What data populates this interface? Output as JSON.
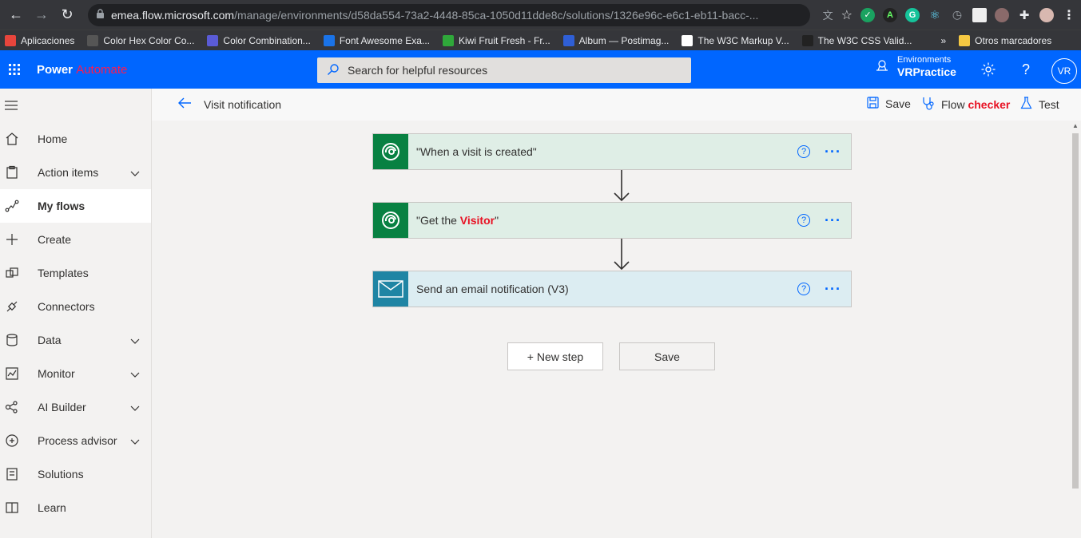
{
  "browser": {
    "url_host": "emea.flow.microsoft.com",
    "url_path": "/manage/environments/d58da554-73a2-4448-85ca-1050d11dde8c/solutions/1326e96c-e6c1-eb11-bacc-..."
  },
  "bookmarks": [
    {
      "label": "Aplicaciones",
      "color": "#e8453c"
    },
    {
      "label": "Color Hex Color Co...",
      "color": "#555555"
    },
    {
      "label": "Color Combination...",
      "color": "#5a5bd6"
    },
    {
      "label": "Font Awesome Exa...",
      "color": "#1a73e8"
    },
    {
      "label": "Kiwi Fruit Fresh - Fr...",
      "color": "#2fa83a"
    },
    {
      "label": "Album — Postimag...",
      "color": "#2f5fd6"
    },
    {
      "label": "The W3C Markup V...",
      "color": "#ffffff"
    },
    {
      "label": "The W3C CSS Valid...",
      "color": "#222222"
    }
  ],
  "bookmarks_overflow": "»",
  "bookmarks_other": "Otros marcadores",
  "header": {
    "brand_1": "Power",
    "brand_2": "Automate",
    "search_placeholder": "Search for helpful resources",
    "env_label": "Environments",
    "env_value": "VRPractice",
    "help": "?",
    "avatar": "VR",
    "accent": "#0066ff"
  },
  "sidebar": {
    "items": [
      {
        "label": "Home",
        "icon": "home-icon",
        "chevron": false
      },
      {
        "label": "Action items",
        "icon": "clipboard-icon",
        "chevron": true
      },
      {
        "label": "My flows",
        "icon": "flows-icon",
        "chevron": false,
        "active": true
      },
      {
        "label": "Create",
        "icon": "plus-icon",
        "chevron": false
      },
      {
        "label": "Templates",
        "icon": "templates-icon",
        "chevron": false
      },
      {
        "label": "Connectors",
        "icon": "connectors-icon",
        "chevron": false
      },
      {
        "label": "Data",
        "icon": "data-icon",
        "chevron": true
      },
      {
        "label": "Monitor",
        "icon": "monitor-icon",
        "chevron": true
      },
      {
        "label": "AI Builder",
        "icon": "ai-builder-icon",
        "chevron": true
      },
      {
        "label": "Process advisor",
        "icon": "process-advisor-icon",
        "chevron": true
      },
      {
        "label": "Solutions",
        "icon": "solutions-icon",
        "chevron": false
      },
      {
        "label": "Learn",
        "icon": "learn-icon",
        "chevron": false
      }
    ]
  },
  "cmdbar": {
    "title": "Visit notification",
    "save": "Save",
    "checker_1": "Flow",
    "checker_2": "checker",
    "test": "Test"
  },
  "steps": [
    {
      "title_pre": "\"When a visit is created\"",
      "title_hl": "",
      "title_post": "",
      "type": "dataverse"
    },
    {
      "title_pre": "\"Get the ",
      "title_hl": "Visitor",
      "title_post": "\"",
      "type": "dataverse"
    },
    {
      "title_pre": "Send an email notification (V3)",
      "title_hl": "",
      "title_post": "",
      "type": "mail"
    }
  ],
  "buttons": {
    "new_step": "+ New step",
    "save": "Save"
  }
}
